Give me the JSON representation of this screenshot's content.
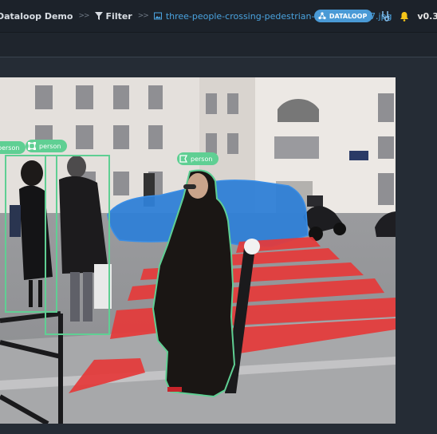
{
  "header": {
    "project": "Dataloop Demo",
    "separator": ">>",
    "filter_label": "Filter",
    "file_name": "three-people-crossing-pedestrian-lane-2567097.jpg",
    "brand_badge": "DATALOOP",
    "version": "v0.3",
    "icons": {
      "filter": "filter-icon",
      "file": "image-file-icon",
      "brand": "dataloop-logo-icon",
      "notifications": "bell-icon",
      "help": "stethoscope-icon"
    }
  },
  "annotations": [
    {
      "label": "person",
      "type": "box"
    },
    {
      "label": "person",
      "type": "box"
    },
    {
      "label": "person",
      "type": "polygon"
    }
  ],
  "colors": {
    "accent": "#4a9ad6",
    "annotation_person": "#5fcf93",
    "car_polygon": "#2f7fd6",
    "crosswalk_polygon": "#e53a3a",
    "bell": "#f5c518"
  }
}
